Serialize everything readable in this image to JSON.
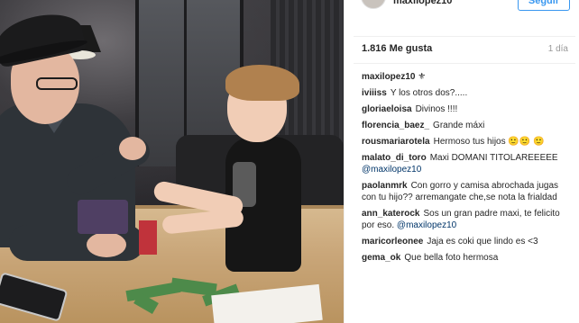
{
  "post": {
    "username": "maxilopez10",
    "follow_label": "Seguir",
    "likes": "1.816 Me gusta",
    "time": "1 día",
    "caption_author": "maxilopez10",
    "caption_emoji": "⚜"
  },
  "comments": [
    {
      "author": "iviiiss",
      "text": "Y los otros dos?.....",
      "mention": ""
    },
    {
      "author": "gloriaeloisa",
      "text": "Divinos !!!!",
      "mention": ""
    },
    {
      "author": "florencia_baez_",
      "text": "Grande máxi",
      "mention": ""
    },
    {
      "author": "rousmariarotela",
      "text": "Hermoso tus hijos 🙂🙂 🙂",
      "mention": ""
    },
    {
      "author": "malato_di_toro",
      "text": "Maxi DOMANI TITOLAREEEEE",
      "mention": "@maxilopez10"
    },
    {
      "author": "paolanmrk",
      "text": "Con gorro y camisa abrochada jugas con tu hijo?? arremangate che,se nota la frialdad",
      "mention": ""
    },
    {
      "author": "ann_katerock",
      "text": "Sos un gran padre maxi, te felicito por eso.",
      "mention": "@maxilopez10"
    },
    {
      "author": "maricorleonee",
      "text": "Jaja es coki que lindo es <3",
      "mention": ""
    },
    {
      "author": "gema_ok",
      "text": "Que bella foto hermosa",
      "mention": ""
    }
  ],
  "colors": {
    "accent": "#3897f0",
    "mention": "#003569",
    "muted": "#999999",
    "text": "#262626"
  },
  "icons": {
    "caption_badge": "fleur-de-lis-icon"
  }
}
